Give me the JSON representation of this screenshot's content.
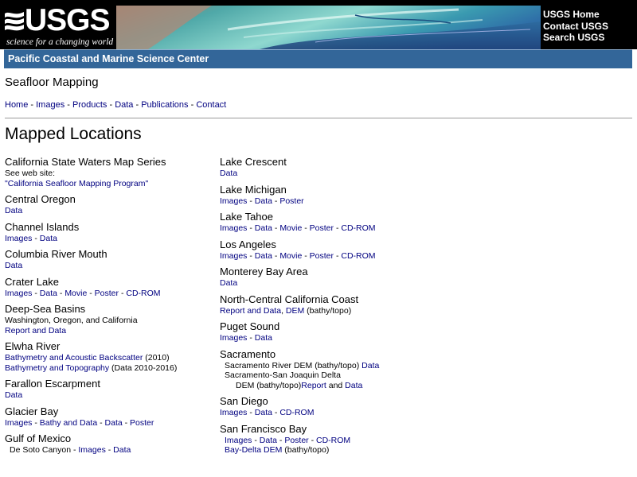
{
  "header": {
    "logo_text": "USGS",
    "logo_tagline": "science for a changing world",
    "links": [
      "USGS Home",
      "Contact USGS",
      "Search USGS"
    ]
  },
  "center": {
    "title": "Pacific Coastal and Marine Science Center"
  },
  "page": {
    "title": "Seafloor Mapping"
  },
  "topnav": [
    "Home",
    "Images",
    "Products",
    "Data",
    "Publications",
    "Contact"
  ],
  "heading": "Mapped Locations",
  "left_column": [
    {
      "title": "California State Waters Map Series",
      "lines": [
        [
          {
            "t": "See web site:"
          }
        ],
        [
          {
            "t": "\"California Seafloor Mapping Program\"",
            "link": true
          }
        ]
      ]
    },
    {
      "title": "Central Oregon",
      "lines": [
        [
          {
            "t": "Data",
            "link": true
          }
        ]
      ]
    },
    {
      "title": "Channel Islands",
      "lines": [
        [
          {
            "t": "Images",
            "link": true
          },
          {
            "t": " - "
          },
          {
            "t": "Data",
            "link": true
          }
        ]
      ]
    },
    {
      "title": "Columbia River Mouth",
      "lines": [
        [
          {
            "t": "Data",
            "link": true
          }
        ]
      ]
    },
    {
      "title": "Crater Lake",
      "lines": [
        [
          {
            "t": "Images",
            "link": true
          },
          {
            "t": " - "
          },
          {
            "t": "Data",
            "link": true
          },
          {
            "t": " - "
          },
          {
            "t": "Movie",
            "link": true
          },
          {
            "t": " - "
          },
          {
            "t": "Poster",
            "link": true
          },
          {
            "t": " - "
          },
          {
            "t": "CD-ROM",
            "link": true
          }
        ]
      ]
    },
    {
      "title": "Deep-Sea Basins",
      "lines": [
        [
          {
            "t": "Washington, Oregon, and California"
          }
        ],
        [
          {
            "t": "Report and Data",
            "link": true
          }
        ]
      ]
    },
    {
      "title": "Elwha River",
      "lines": [
        [
          {
            "t": "Bathymetry and Acoustic Backscatter",
            "link": true
          },
          {
            "t": " (2010)"
          }
        ],
        [
          {
            "t": "Bathymetry and Topography",
            "link": true
          },
          {
            "t": " (Data 2010-2016)"
          }
        ]
      ]
    },
    {
      "title": "Farallon Escarpment",
      "lines": [
        [
          {
            "t": "Data",
            "link": true
          }
        ]
      ]
    },
    {
      "title": "Glacier Bay",
      "lines": [
        [
          {
            "t": "Images",
            "link": true
          },
          {
            "t": " - "
          },
          {
            "t": "Bathy and Data",
            "link": true
          },
          {
            "t": " - "
          },
          {
            "t": "Data",
            "link": true
          },
          {
            "t": " - "
          },
          {
            "t": "Poster",
            "link": true
          }
        ]
      ]
    },
    {
      "title": "Gulf of Mexico",
      "lines": [
        [
          {
            "t": "De Soto Canyon - "
          },
          {
            "t": "Images",
            "link": true
          },
          {
            "t": " - "
          },
          {
            "t": "Data",
            "link": true
          }
        ]
      ],
      "indent": 1
    }
  ],
  "right_column": [
    {
      "title": "Lake Crescent",
      "lines": [
        [
          {
            "t": "Data",
            "link": true
          }
        ]
      ]
    },
    {
      "title": "Lake Michigan",
      "lines": [
        [
          {
            "t": "Images",
            "link": true
          },
          {
            "t": " - "
          },
          {
            "t": "Data",
            "link": true
          },
          {
            "t": " - "
          },
          {
            "t": "Poster",
            "link": true
          }
        ]
      ]
    },
    {
      "title": "Lake Tahoe",
      "lines": [
        [
          {
            "t": "Images",
            "link": true
          },
          {
            "t": " - "
          },
          {
            "t": "Data",
            "link": true
          },
          {
            "t": " - "
          },
          {
            "t": "Movie",
            "link": true
          },
          {
            "t": " - "
          },
          {
            "t": "Poster",
            "link": true
          },
          {
            "t": " - "
          },
          {
            "t": "CD-ROM",
            "link": true
          }
        ]
      ]
    },
    {
      "title": "Los Angeles",
      "lines": [
        [
          {
            "t": "Images",
            "link": true
          },
          {
            "t": " - "
          },
          {
            "t": "Data",
            "link": true
          },
          {
            "t": " - "
          },
          {
            "t": "Movie",
            "link": true
          },
          {
            "t": " - "
          },
          {
            "t": "Poster",
            "link": true
          },
          {
            "t": " - "
          },
          {
            "t": "CD-ROM",
            "link": true
          }
        ]
      ]
    },
    {
      "title": "Monterey Bay Area",
      "lines": [
        [
          {
            "t": "Data",
            "link": true
          }
        ]
      ]
    },
    {
      "title": "North-Central California Coast",
      "lines": [
        [
          {
            "t": "Report and Data",
            "link": true
          },
          {
            "t": ", "
          },
          {
            "t": "DEM",
            "link": true
          },
          {
            "t": " (bathy/topo)"
          }
        ]
      ]
    },
    {
      "title": "Puget Sound",
      "lines": [
        [
          {
            "t": "Images",
            "link": true
          },
          {
            "t": " - "
          },
          {
            "t": "Data",
            "link": true
          }
        ]
      ]
    },
    {
      "title": "Sacramento",
      "lines": [
        [
          {
            "t": "Sacramento River DEM (bathy/topo) "
          },
          {
            "t": "Data",
            "link": true
          }
        ],
        [
          {
            "t": "Sacramento-San Joaquin Delta"
          }
        ],
        [
          {
            "t": "DEM (bathy/topo) ",
            "indent": 2
          },
          {
            "t": "Report",
            "link": true
          },
          {
            "t": " and "
          },
          {
            "t": "Data",
            "link": true
          }
        ]
      ],
      "indent": 1
    },
    {
      "title": "San Diego",
      "lines": [
        [
          {
            "t": "Images",
            "link": true
          },
          {
            "t": " - "
          },
          {
            "t": "Data",
            "link": true
          },
          {
            "t": " - "
          },
          {
            "t": "CD-ROM",
            "link": true
          }
        ]
      ]
    },
    {
      "title": "San Francisco Bay",
      "lines": [
        [
          {
            "t": "Images",
            "link": true
          },
          {
            "t": " - "
          },
          {
            "t": "Data",
            "link": true
          },
          {
            "t": " - "
          },
          {
            "t": "Poster",
            "link": true
          },
          {
            "t": " - "
          },
          {
            "t": "CD-ROM",
            "link": true
          }
        ],
        [
          {
            "t": "Bay-Delta DEM",
            "link": true
          },
          {
            "t": " (bathy/topo)"
          }
        ]
      ],
      "indent": 1
    }
  ],
  "colors": {
    "banner_bg": "#000000",
    "center_bar": "#336699",
    "link": "#000080"
  }
}
